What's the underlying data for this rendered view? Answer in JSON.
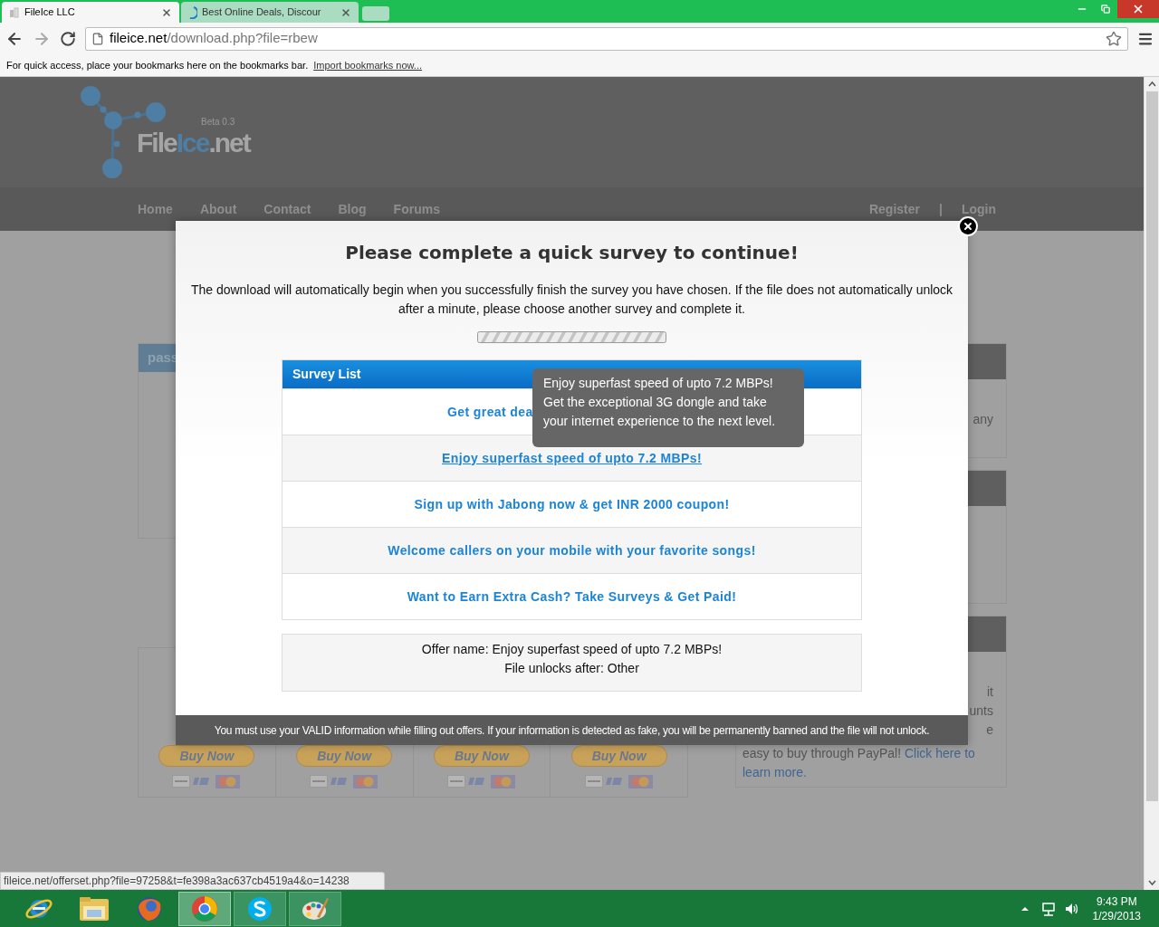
{
  "browser": {
    "tabs": [
      {
        "title": "FileIce LLC",
        "selected": true
      },
      {
        "title": "Best Online Deals, Discour",
        "selected": false
      }
    ],
    "address": {
      "domain": "fileice.net",
      "path": "/download.php?file=rbew"
    },
    "bookmarks_bar": {
      "message": "For quick access, place your bookmarks here on the bookmarks bar.",
      "link": "Import bookmarks now..."
    },
    "status_url": "fileice.net/offerset.php?file=97258&t=fe398a3ac637cb4519a4&o=14238"
  },
  "site": {
    "logo": {
      "parts": [
        "File",
        "Ice",
        ".net"
      ],
      "badge": "Beta 0.3"
    },
    "nav": [
      "Home",
      "About",
      "Contact",
      "Blog",
      "Forums"
    ],
    "nav_right": {
      "register": "Register",
      "separator": "|",
      "login": "Login"
    },
    "left_panel": {
      "header": "pass"
    },
    "right_panels": [
      {
        "kind": "text",
        "lines": [
          "any"
        ]
      },
      {
        "kind": "blank"
      },
      {
        "kind": "text",
        "lines": [
          "it",
          "unts",
          "e"
        ],
        "paragraph": "easy to buy through PayPal! ",
        "link_1": "Click here to",
        "link_2": "learn more."
      }
    ],
    "buy_buttons": [
      "Buy Now",
      "Buy Now",
      "Buy Now",
      "Buy Now"
    ]
  },
  "modal": {
    "title": "Please complete a quick survey to continue!",
    "description": "The download will automatically begin when you successfully finish the survey you have chosen. If the file does not automatically unlock after a minute, please choose another survey and complete it.",
    "survey_list": {
      "header": "Survey List",
      "rows": [
        {
          "kind": "covered",
          "text": "Get great dea",
          "hovered": false
        },
        {
          "kind": "link",
          "text": "Enjoy superfast speed of upto 7.2 MBPs!",
          "hovered": true
        },
        {
          "kind": "link",
          "text": "Sign up with Jabong now & get INR 2000 coupon!",
          "hovered": false
        },
        {
          "kind": "link",
          "text": "Welcome callers on your mobile with your favorite songs!",
          "hovered": false
        },
        {
          "kind": "link",
          "text": "Want to Earn Extra Cash? Take Surveys & Get Paid!",
          "hovered": false
        }
      ]
    },
    "tooltip": "Enjoy superfast speed of upto 7.2 MBPs! Get the exceptional 3G dongle and take your internet experience to the next level.",
    "offer": {
      "name": "Offer name: Enjoy superfast speed of upto 7.2 MBPs!",
      "unlocks": "File unlocks after: Other"
    },
    "warning": "You must use your VALID information while filling out offers. If your information is detected as fake, you will be permanently banned and the file will not unlock."
  },
  "taskbar": {
    "apps": [
      {
        "kind": "ie",
        "selected": false
      },
      {
        "kind": "folder",
        "selected": false
      },
      {
        "kind": "firefox",
        "selected": false
      },
      {
        "kind": "chrome",
        "selected": true
      },
      {
        "kind": "skype",
        "selected": false
      },
      {
        "kind": "paint",
        "selected": false
      }
    ],
    "time": "9:43 PM",
    "date": "1/29/2013"
  }
}
